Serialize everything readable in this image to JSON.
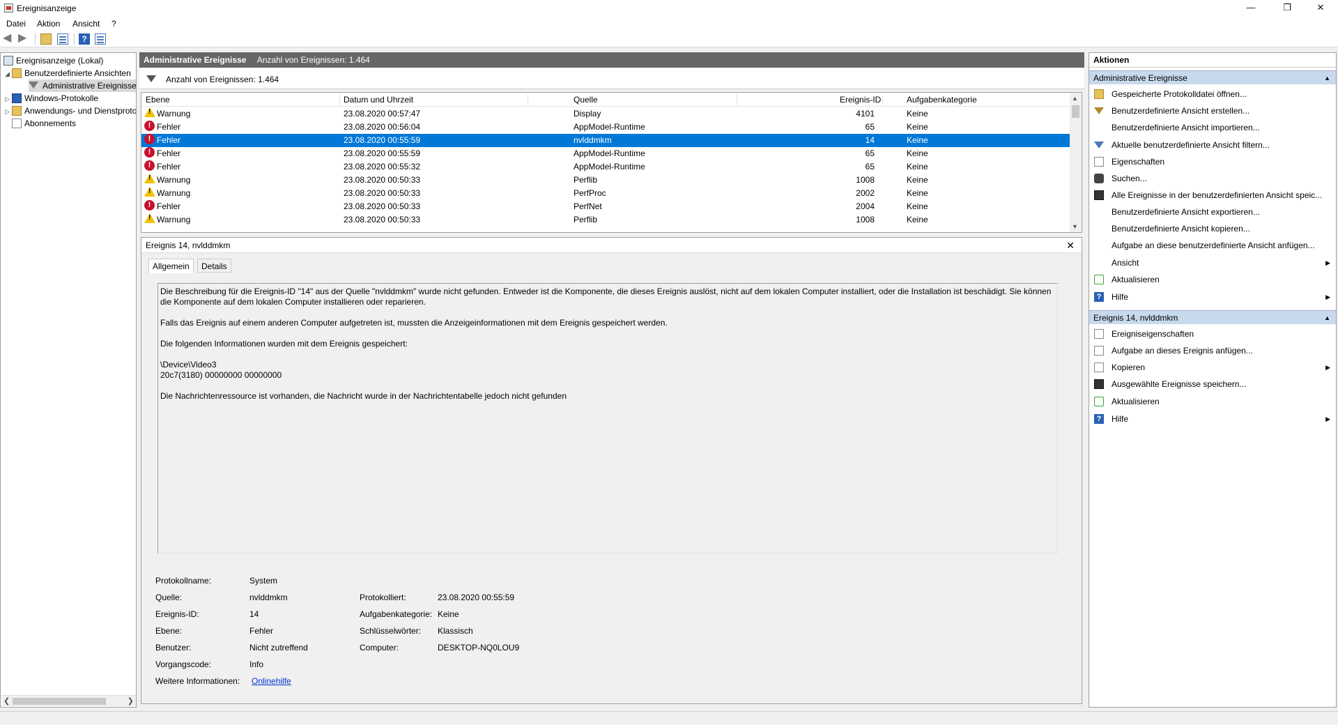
{
  "window": {
    "title": "Ereignisanzeige",
    "minimize": "—",
    "maximize": "❐",
    "close": "✕"
  },
  "menu": [
    "Datei",
    "Aktion",
    "Ansicht",
    "?"
  ],
  "tree": {
    "root": "Ereignisanzeige (Lokal)",
    "custom_views": "Benutzerdefinierte Ansichten",
    "admin_events": "Administrative Ereignisse",
    "windows_logs": "Windows-Protokolle",
    "app_service_logs": "Anwendungs- und Dienstprotokolle",
    "subscriptions": "Abonnements"
  },
  "center": {
    "header_title": "Administrative Ereignisse",
    "header_count": "Anzahl von Ereignissen: 1.464",
    "filter_text": "Anzahl von Ereignissen: 1.464",
    "columns": [
      "Ebene",
      "Datum und Uhrzeit",
      "Quelle",
      "Ereignis-ID",
      "Aufgabenkategorie"
    ],
    "rows": [
      {
        "level": "Warnung",
        "type": "warn",
        "date": "23.08.2020 00:57:47",
        "source": "Display",
        "id": "4101",
        "task": "Keine"
      },
      {
        "level": "Fehler",
        "type": "err",
        "date": "23.08.2020 00:56:04",
        "source": "AppModel-Runtime",
        "id": "65",
        "task": "Keine"
      },
      {
        "level": "Fehler",
        "type": "err",
        "date": "23.08.2020 00:55:59",
        "source": "nvlddmkm",
        "id": "14",
        "task": "Keine"
      },
      {
        "level": "Fehler",
        "type": "err",
        "date": "23.08.2020 00:55:59",
        "source": "AppModel-Runtime",
        "id": "65",
        "task": "Keine"
      },
      {
        "level": "Fehler",
        "type": "err",
        "date": "23.08.2020 00:55:32",
        "source": "AppModel-Runtime",
        "id": "65",
        "task": "Keine"
      },
      {
        "level": "Warnung",
        "type": "warn",
        "date": "23.08.2020 00:50:33",
        "source": "Perflib",
        "id": "1008",
        "task": "Keine"
      },
      {
        "level": "Warnung",
        "type": "warn",
        "date": "23.08.2020 00:50:33",
        "source": "PerfProc",
        "id": "2002",
        "task": "Keine"
      },
      {
        "level": "Fehler",
        "type": "err",
        "date": "23.08.2020 00:50:33",
        "source": "PerfNet",
        "id": "2004",
        "task": "Keine"
      },
      {
        "level": "Warnung",
        "type": "warn",
        "date": "23.08.2020 00:50:33",
        "source": "Perflib",
        "id": "1008",
        "task": "Keine"
      }
    ]
  },
  "detail": {
    "title": "Ereignis 14, nvlddmkm",
    "tabs": [
      "Allgemein",
      "Details"
    ],
    "paragraphs": [
      "Die Beschreibung für die Ereignis-ID \"14\" aus der Quelle \"nvlddmkm\" wurde nicht gefunden. Entweder ist die Komponente, die dieses Ereignis auslöst, nicht auf dem lokalen Computer installiert, oder die Installation ist beschädigt. Sie können die Komponente auf dem lokalen Computer installieren oder reparieren.",
      "Falls das Ereignis auf einem anderen Computer aufgetreten ist, mussten die Anzeigeinformationen mit dem Ereignis gespeichert werden.",
      "Die folgenden Informationen wurden mit dem Ereignis gespeichert:",
      "\\Device\\Video3",
      "20c7(3180) 00000000 00000000",
      "Die Nachrichtenressource ist vorhanden, die Nachricht wurde in der Nachrichtentabelle jedoch nicht gefunden"
    ],
    "props": {
      "log_name_label": "Protokollname:",
      "log_name": "System",
      "source_label": "Quelle:",
      "source": "nvlddmkm",
      "logged_label": "Protokolliert:",
      "logged": "23.08.2020 00:55:59",
      "event_id_label": "Ereignis-ID:",
      "event_id": "14",
      "task_label": "Aufgabenkategorie:",
      "task": "Keine",
      "level_label": "Ebene:",
      "level": "Fehler",
      "keywords_label": "Schlüsselwörter:",
      "keywords": "Klassisch",
      "user_label": "Benutzer:",
      "user": "Nicht zutreffend",
      "computer_label": "Computer:",
      "computer": "DESKTOP-NQ0LOU9",
      "opcode_label": "Vorgangscode:",
      "opcode": "Info",
      "more_info_label": "Weitere Informationen:",
      "more_info": "Onlinehilfe"
    }
  },
  "actions": {
    "header": "Aktionen",
    "section1": "Administrative Ereignisse",
    "items1": [
      {
        "label": "Gespeicherte Protokolldatei öffnen...",
        "icon": "open-icon"
      },
      {
        "label": "Benutzerdefinierte Ansicht erstellen...",
        "icon": "filter-icon"
      },
      {
        "label": "Benutzerdefinierte Ansicht importieren...",
        "icon": ""
      },
      {
        "label": "Aktuelle benutzerdefinierte Ansicht filtern...",
        "icon": "filter-icon"
      },
      {
        "label": "Eigenschaften",
        "icon": "properties-icon"
      },
      {
        "label": "Suchen...",
        "icon": "find-icon"
      },
      {
        "label": "Alle Ereignisse in der benutzerdefinierten Ansicht speic...",
        "icon": "save-icon"
      },
      {
        "label": "Benutzerdefinierte Ansicht exportieren...",
        "icon": ""
      },
      {
        "label": "Benutzerdefinierte Ansicht kopieren...",
        "icon": ""
      },
      {
        "label": "Aufgabe an diese benutzerdefinierte Ansicht anfügen...",
        "icon": ""
      },
      {
        "label": "Ansicht",
        "icon": ""
      },
      {
        "label": "Aktualisieren",
        "icon": "refresh-icon"
      },
      {
        "label": "Hilfe",
        "icon": "help-icon"
      }
    ],
    "section2": "Ereignis 14, nvlddmkm",
    "items2": [
      {
        "label": "Ereigniseigenschaften",
        "icon": "properties-icon"
      },
      {
        "label": "Aufgabe an dieses Ereignis anfügen...",
        "icon": "task-icon"
      },
      {
        "label": "Kopieren",
        "icon": "copy-icon"
      },
      {
        "label": "Ausgewählte Ereignisse speichern...",
        "icon": "save-icon"
      },
      {
        "label": "Aktualisieren",
        "icon": "refresh-icon"
      },
      {
        "label": "Hilfe",
        "icon": "help-icon"
      }
    ]
  }
}
